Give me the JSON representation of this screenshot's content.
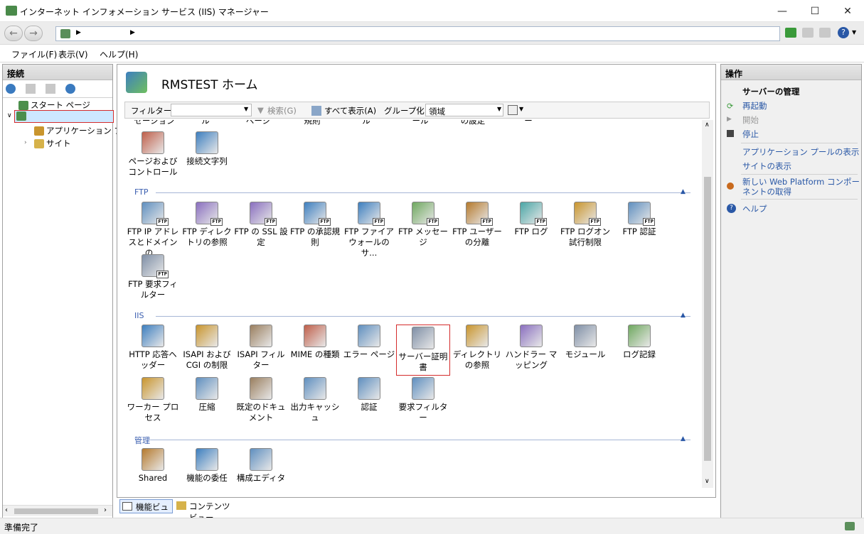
{
  "window": {
    "title": "インターネット インフォメーション サービス (IIS) マネージャー",
    "minimize": "—",
    "maximize": "☐",
    "close": "✕"
  },
  "menu": {
    "file": "ファイル(F)",
    "view": "表示(V)",
    "help": "ヘルプ(H)"
  },
  "connections": {
    "header": "接続",
    "tree": {
      "start_page": "スタート ページ",
      "server": "",
      "app_pools": "アプリケーション プール",
      "sites": "サイト"
    }
  },
  "center": {
    "title": "RMSTEST ホーム",
    "filter": {
      "label": "フィルター:",
      "search": "検索(G)",
      "show_all": "すべて表示(A)",
      "group_by": "グループ化:",
      "group_value": "領域"
    },
    "cut_labels": [
      "セーション",
      "ル",
      "ページ",
      "規則",
      "ル",
      "ール",
      "の設定",
      "ー"
    ],
    "aspnet_items": [
      {
        "label": "ページおよびコントロール",
        "icon": "pages-controls-icon"
      },
      {
        "label": "接続文字列",
        "icon": "connection-strings-icon"
      }
    ],
    "groups": {
      "ftp": "FTP",
      "iis": "IIS",
      "management": "管理"
    },
    "ftp_items": [
      {
        "label": "FTP IP アドレスとドメインの...",
        "icon": "ftp-ip-restrictions-icon"
      },
      {
        "label": "FTP ディレクトリの参照",
        "icon": "ftp-directory-browsing-icon"
      },
      {
        "label": "FTP の SSL 設定",
        "icon": "ftp-ssl-icon"
      },
      {
        "label": "FTP の承認規則",
        "icon": "ftp-authorization-icon"
      },
      {
        "label": "FTP ファイアウォールのサ...",
        "icon": "ftp-firewall-icon"
      },
      {
        "label": "FTP メッセージ",
        "icon": "ftp-messages-icon"
      },
      {
        "label": "FTP ユーザーの分離",
        "icon": "ftp-user-isolation-icon"
      },
      {
        "label": "FTP ログ",
        "icon": "ftp-logging-icon"
      },
      {
        "label": "FTP ログオン試行制限",
        "icon": "ftp-logon-attempt-icon"
      },
      {
        "label": "FTP 認証",
        "icon": "ftp-authentication-icon"
      },
      {
        "label": "FTP 要求フィルター",
        "icon": "ftp-request-filtering-icon"
      }
    ],
    "iis_items": [
      {
        "label": "HTTP 応答ヘッダー",
        "icon": "http-response-headers-icon"
      },
      {
        "label": "ISAPI および CGI の制限",
        "icon": "isapi-cgi-restrictions-icon"
      },
      {
        "label": "ISAPI フィルター",
        "icon": "isapi-filters-icon"
      },
      {
        "label": "MIME の種類",
        "icon": "mime-types-icon"
      },
      {
        "label": "エラー ページ",
        "icon": "error-pages-icon"
      },
      {
        "label": "サーバー証明書",
        "icon": "server-certificates-icon"
      },
      {
        "label": "ディレクトリの参照",
        "icon": "directory-browsing-icon"
      },
      {
        "label": "ハンドラー マッピング",
        "icon": "handler-mappings-icon"
      },
      {
        "label": "モジュール",
        "icon": "modules-icon"
      },
      {
        "label": "ログ記録",
        "icon": "logging-icon"
      },
      {
        "label": "ワーカー プロセス",
        "icon": "worker-processes-icon"
      },
      {
        "label": "圧縮",
        "icon": "compression-icon"
      },
      {
        "label": "既定のドキュメント",
        "icon": "default-document-icon"
      },
      {
        "label": "出力キャッシュ",
        "icon": "output-caching-icon"
      },
      {
        "label": "認証",
        "icon": "authentication-icon"
      },
      {
        "label": "要求フィルター",
        "icon": "request-filtering-icon"
      }
    ],
    "mgmt_items": [
      {
        "label": "Shared",
        "icon": "shared-config-icon"
      },
      {
        "label": "機能の委任",
        "icon": "feature-delegation-icon"
      },
      {
        "label": "構成エディター",
        "icon": "configuration-editor-icon"
      }
    ],
    "views": {
      "features": "機能ビュー",
      "content": "コンテンツ ビュー"
    }
  },
  "actions": {
    "header": "操作",
    "server_manage": "サーバーの管理",
    "restart": "再起動",
    "start": "開始",
    "stop": "停止",
    "view_app_pools": "アプリケーション プールの表示",
    "view_sites": "サイトの表示",
    "web_platform": "新しい Web Platform コンポーネントの取得",
    "help": "ヘルプ"
  },
  "status": {
    "text": "準備完了"
  }
}
